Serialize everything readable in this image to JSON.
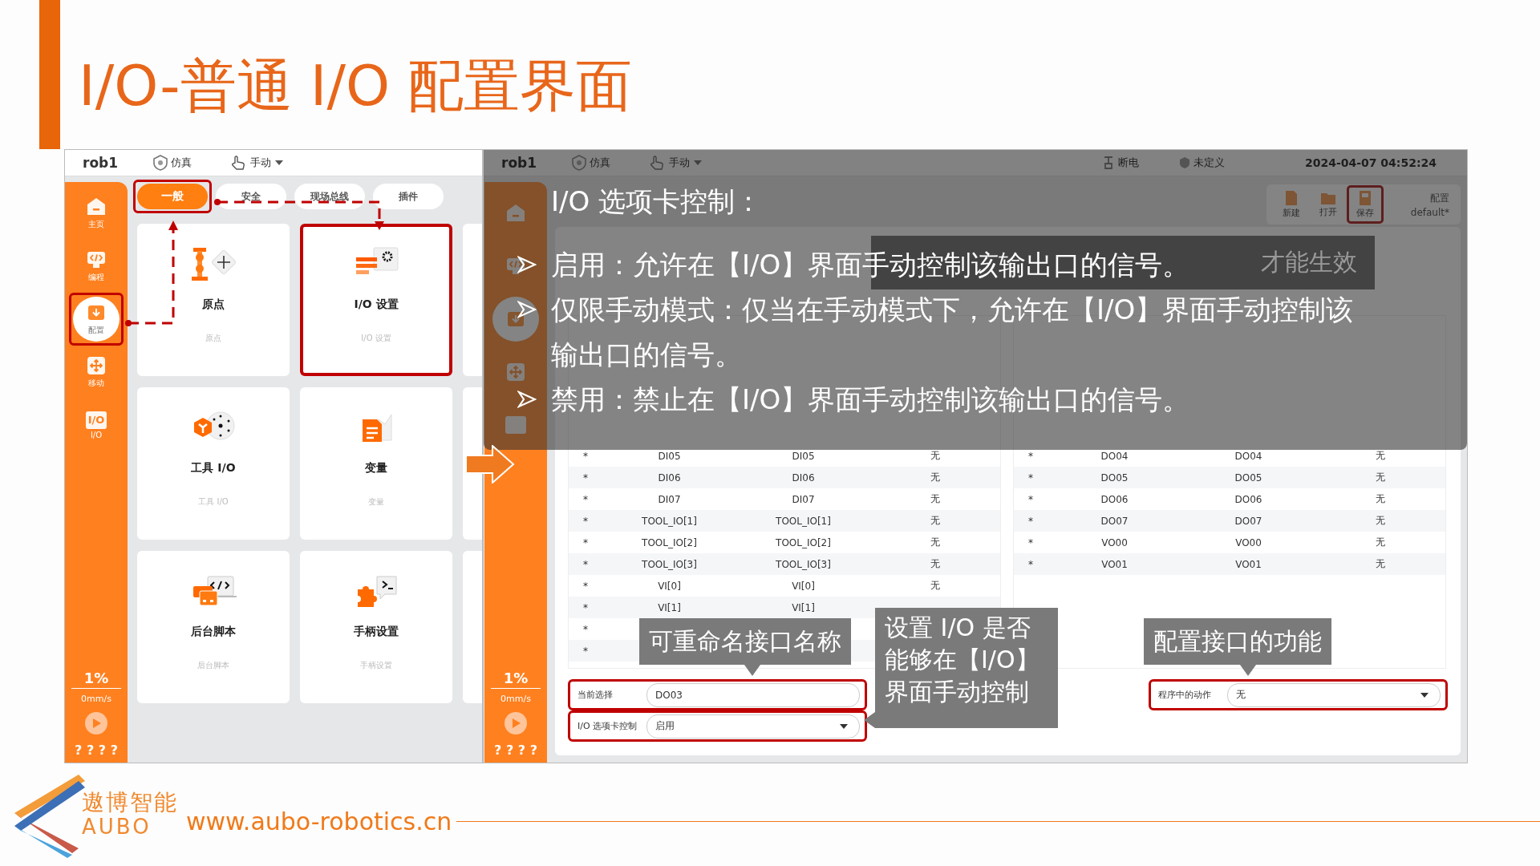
{
  "title": "I/O-普通 I/O 配置界面",
  "left_screen": {
    "header": {
      "robot": "rob1",
      "mode": "仿真",
      "control": "手动"
    },
    "sidebar": {
      "items": [
        {
          "kind": "home",
          "label": "主页",
          "selected": false,
          "highlighted": false
        },
        {
          "kind": "program",
          "label": "编程",
          "selected": false,
          "highlighted": false
        },
        {
          "kind": "config",
          "label": "配置",
          "selected": true,
          "highlighted": true
        },
        {
          "kind": "move",
          "label": "移动",
          "selected": false,
          "highlighted": false
        },
        {
          "kind": "io",
          "icon_text": "I/O",
          "label": "I/O",
          "selected": false,
          "highlighted": false
        }
      ],
      "speed_ratio": "1%",
      "speed": "0mm/s",
      "footer": "? ? ? ?"
    },
    "tabs": [
      {
        "label": "一般",
        "selected": true,
        "highlighted": true
      },
      {
        "label": "安全",
        "selected": false,
        "highlighted": false
      },
      {
        "label": "现场总线",
        "selected": false,
        "highlighted": false
      },
      {
        "label": "插件",
        "selected": false,
        "highlighted": false
      }
    ],
    "cards": [
      {
        "kind": "origin",
        "title": "原点",
        "subtitle": "原点",
        "highlighted": false
      },
      {
        "kind": "io_settings",
        "title": "I/O 设置",
        "subtitle": "I/O 设置",
        "highlighted": true
      },
      {
        "kind": "tool_io",
        "title": "工具 I/O",
        "subtitle": "工具 I/O",
        "highlighted": false
      },
      {
        "kind": "variables",
        "title": "变量",
        "subtitle": "变量",
        "highlighted": false
      },
      {
        "kind": "script",
        "title": "后台脚本",
        "subtitle": "后台脚本",
        "highlighted": false
      },
      {
        "kind": "handle",
        "title": "手柄设置",
        "subtitle": "手柄设置",
        "highlighted": false
      }
    ]
  },
  "right_screen": {
    "header": {
      "robot": "rob1",
      "mode": "仿真",
      "control": "手动",
      "power": "断电",
      "status": "未定义",
      "datetime": "2024-04-07 04:52:24"
    },
    "sidebar": {
      "items": [
        {
          "kind": "home",
          "selected": false,
          "highlighted": false
        },
        {
          "kind": "program",
          "selected": false,
          "highlighted": false
        },
        {
          "kind": "config",
          "selected": true,
          "highlighted": false
        },
        {
          "kind": "move",
          "selected": false,
          "highlighted": false
        },
        {
          "kind": "io",
          "selected": false,
          "highlighted": false
        }
      ],
      "speed_ratio": "1%",
      "speed": "0mm/s",
      "footer": "? ? ? ?"
    },
    "toolbar": {
      "buttons": [
        {
          "kind": "new",
          "label": "新建",
          "highlighted": false
        },
        {
          "kind": "open",
          "label": "打开",
          "highlighted": false
        },
        {
          "kind": "save",
          "label": "保存",
          "highlighted": true
        }
      ],
      "config_label": "配置",
      "config_value": "default*"
    },
    "inputs": {
      "rows": [
        [
          "*",
          "DI05",
          "DI05",
          "无"
        ],
        [
          "*",
          "DI06",
          "DI06",
          "无"
        ],
        [
          "*",
          "DI07",
          "DI07",
          "无"
        ],
        [
          "*",
          "TOOL_IO[1]",
          "TOOL_IO[1]",
          "无"
        ],
        [
          "*",
          "TOOL_IO[2]",
          "TOOL_IO[2]",
          "无"
        ],
        [
          "*",
          "TOOL_IO[3]",
          "TOOL_IO[3]",
          "无"
        ],
        [
          "*",
          "VI[0]",
          "VI[0]",
          "无"
        ],
        [
          "*",
          "VI[1]",
          "VI[1]"
        ],
        [
          "*"
        ],
        [
          "*"
        ]
      ]
    },
    "outputs": {
      "rows": [
        [
          "*",
          "DO04",
          "DO04",
          "无"
        ],
        [
          "*",
          "DO05",
          "DO05",
          "无"
        ],
        [
          "*",
          "DO06",
          "DO06",
          "无"
        ],
        [
          "*",
          "DO07",
          "DO07",
          "无"
        ],
        [
          "*",
          "VO00",
          "VO00",
          "无"
        ],
        [
          "*",
          "VO01",
          "VO01",
          "无"
        ]
      ]
    },
    "current_selection": {
      "label": "当前选择",
      "value": "DO03",
      "highlighted": true
    },
    "tab_control": {
      "label": "I/O 选项卡控制",
      "value": "启用",
      "highlighted": true
    },
    "program_action": {
      "label": "程序中的动作",
      "value": "无",
      "highlighted": true
    },
    "toast": "才能生效",
    "note": {
      "title": "I/O 选项卡控制：",
      "bullets": [
        "启用：允许在【I/O】界面手动控制该输出口的信号。",
        "仅限手动模式：仅当在手动模式下，允许在【I/O】界面手动控制该输出口的信号。",
        "禁用：禁止在【I/O】界面手动控制该输出口的信号。"
      ]
    },
    "callouts": [
      {
        "kind": "down",
        "text": "可重命名接口名称"
      },
      {
        "kind": "left",
        "text": "设置 I/O 是否能够在【I/O】界面手动控制"
      },
      {
        "kind": "down",
        "text": "配置接口的功能"
      }
    ]
  },
  "footer": {
    "brand_cn": "遨博智能",
    "brand_en": "AUBO",
    "website": "www.aubo-robotics.cn"
  }
}
